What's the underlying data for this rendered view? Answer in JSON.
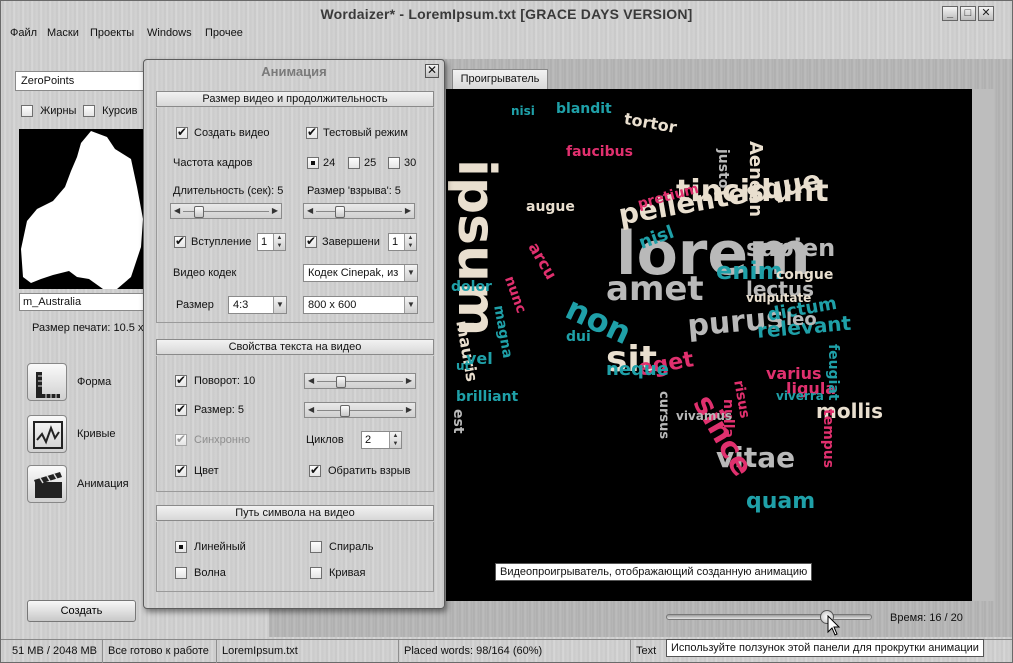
{
  "window": {
    "title": "Wordaizer* - LoremIpsum.txt      [GRACE DAYS VERSION]",
    "minimize": "_",
    "maximize": "□",
    "close": "✕"
  },
  "menu": [
    "Файл",
    "Маски",
    "Проекты",
    "Windows",
    "Прочее"
  ],
  "left_pane": {
    "mask_select": "ZeroPoints",
    "bold_label": "Жирны",
    "italic_label": "Курсив",
    "mask_name": "m_Australia",
    "print_size": "Размер печати: 10.5 x",
    "tools": [
      {
        "label": "Форма",
        "icon": "ruler-icon"
      },
      {
        "label": "Кривые",
        "icon": "curve-icon"
      },
      {
        "label": "Анимация",
        "icon": "clapperboard-icon"
      }
    ],
    "create_button": "Создать"
  },
  "right_pane": {
    "tab": "Проигрыватель",
    "tooltip_video": "Видеопроигрыватель, отображающий созданную анимацию",
    "time_label": "Время: 16 / 20",
    "time_progress": 0.8,
    "tooltip_slider": "Используйте ползунок этой панели для прокрутки анимации"
  },
  "dialog": {
    "title": "Анимация",
    "close": "✕",
    "video_group": {
      "heading": "Размер видео и продолжительность",
      "create_video": "Создать видео",
      "test_mode": "Тестовый режим",
      "fps_label": "Частота кадров",
      "fps_options": [
        "24",
        "25",
        "30"
      ],
      "duration_label": "Длительность (сек): 5",
      "burst_label": "Размер 'взрыва': 5",
      "intro_label": "Вступление",
      "intro_value": "1",
      "outro_label": "Завершени",
      "outro_value": "1",
      "codec_label": "Видео кодек",
      "codec_value": "Кодек Cinepak, из",
      "size_label": "Размер",
      "aspect_value": "4:3",
      "resolution_value": "800 x 600",
      "duration_level": 0.15,
      "burst_level": 0.25
    },
    "text_group": {
      "heading": "Свойства текста на видео",
      "rotation_label": "Поворот: 10",
      "size_label": "Размер: 5",
      "sync_label": "Синхронно",
      "cycles_label": "Циклов",
      "cycles_value": "2",
      "color_label": "Цвет",
      "reverse_label": "Обратить взрыв",
      "rotation_level": 0.25,
      "size_level": 0.3
    },
    "path_group": {
      "heading": "Путь символа на видео",
      "linear": "Линейный",
      "spiral": "Спираль",
      "wave": "Волна",
      "curve": "Кривая"
    }
  },
  "status": {
    "memory": "51 MB / 2048 MB",
    "state": "Все готово к работе",
    "file": "LoremIpsum.txt",
    "placed": "Placed words: 98/164 (60%)",
    "text": "Text"
  },
  "colors": {
    "pink": "#e0306e",
    "teal": "#1fa0a8",
    "cream": "#e9dfcf",
    "gray": "#b9b9b9"
  },
  "word_cloud": [
    {
      "t": "lorem",
      "c": "gray"
    },
    {
      "t": "ipsum",
      "c": "cream"
    },
    {
      "t": "amet",
      "c": "gray"
    },
    {
      "t": "tincidunt",
      "c": "cream"
    },
    {
      "t": "pellentesque",
      "c": "cream"
    },
    {
      "t": "purus",
      "c": "gray"
    },
    {
      "t": "vitae",
      "c": "gray"
    },
    {
      "t": "quam",
      "c": "teal"
    },
    {
      "t": "mollis",
      "c": "cream"
    },
    {
      "t": "since",
      "c": "pink"
    },
    {
      "t": "sit",
      "c": "cream"
    },
    {
      "t": "non",
      "c": "teal"
    },
    {
      "t": "enim",
      "c": "teal"
    },
    {
      "t": "sapien",
      "c": "gray"
    },
    {
      "t": "Aenean",
      "c": "cream"
    },
    {
      "t": "relevant",
      "c": "teal"
    },
    {
      "t": "dictum",
      "c": "teal"
    },
    {
      "t": "lectus",
      "c": "gray"
    },
    {
      "t": "congue",
      "c": "cream"
    },
    {
      "t": "faucibus",
      "c": "pink"
    },
    {
      "t": "pretium",
      "c": "pink"
    },
    {
      "t": "blandit",
      "c": "teal"
    },
    {
      "t": "tortor",
      "c": "cream"
    },
    {
      "t": "justo",
      "c": "gray"
    },
    {
      "t": "augue",
      "c": "cream"
    },
    {
      "t": "nisl",
      "c": "teal"
    },
    {
      "t": "arcu",
      "c": "pink"
    },
    {
      "t": "nunc",
      "c": "pink"
    },
    {
      "t": "mauris",
      "c": "cream"
    },
    {
      "t": "ligula",
      "c": "pink"
    },
    {
      "t": "magna",
      "c": "teal"
    },
    {
      "t": "cursus",
      "c": "gray"
    },
    {
      "t": "brilliant",
      "c": "teal"
    },
    {
      "t": "varius",
      "c": "pink"
    },
    {
      "t": "feugiat",
      "c": "teal"
    },
    {
      "t": "dolor",
      "c": "teal"
    },
    {
      "t": "eget",
      "c": "pink"
    },
    {
      "t": "nulla",
      "c": "pink"
    },
    {
      "t": "leo",
      "c": "gray"
    },
    {
      "t": "vel",
      "c": "teal"
    },
    {
      "t": "neque",
      "c": "teal"
    },
    {
      "t": "tempus",
      "c": "pink"
    },
    {
      "t": "vulputate",
      "c": "cream"
    },
    {
      "t": "risus",
      "c": "pink"
    },
    {
      "t": "ut",
      "c": "teal"
    },
    {
      "t": "nisi",
      "c": "teal"
    },
    {
      "t": "dui",
      "c": "teal"
    },
    {
      "t": "est",
      "c": "gray"
    },
    {
      "t": "vivamus",
      "c": "gray"
    },
    {
      "t": "viverra",
      "c": "teal"
    }
  ]
}
